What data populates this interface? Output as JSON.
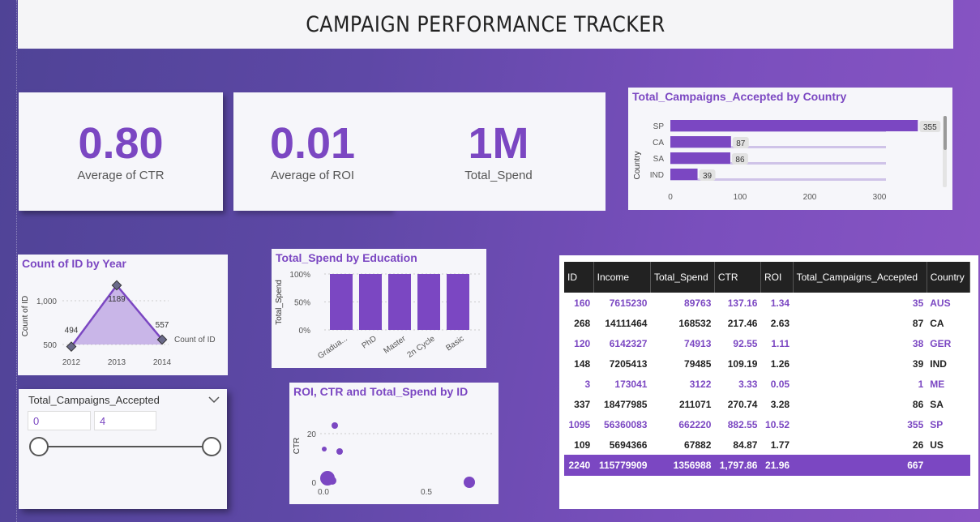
{
  "title": "CAMPAIGN PERFORMANCE TRACKER",
  "kpis": [
    {
      "value": "0.80",
      "label": "Average of CTR"
    },
    {
      "value": "0.01",
      "label": "Average of ROI"
    },
    {
      "value": "1M",
      "label": "Total_Spend"
    }
  ],
  "country_chart": {
    "title": "Total_Campaigns_Accepted by Country",
    "ylabel": "Country",
    "categories": [
      "SP",
      "CA",
      "SA",
      "IND"
    ],
    "values": [
      355,
      87,
      86,
      39
    ],
    "ticks": [
      "0",
      "100",
      "200",
      "300"
    ]
  },
  "year_chart": {
    "title": "Count of ID by Year",
    "ylabel": "Count of ID",
    "legend": "Count of ID",
    "years": [
      "2012",
      "2013",
      "2014"
    ],
    "values": [
      494,
      1189,
      557
    ],
    "labels": [
      "494",
      "1189",
      "557"
    ],
    "yticks": [
      "500",
      "1,000"
    ]
  },
  "education_chart": {
    "title": "Total_Spend by Education",
    "ylabel": "Total_Spend",
    "categories": [
      "Gradua...",
      "PhD",
      "Master",
      "2n Cycle",
      "Basic"
    ],
    "values": [
      100,
      100,
      100,
      100,
      100
    ],
    "yticks": [
      "0%",
      "50%",
      "100%"
    ]
  },
  "scatter_chart": {
    "title": "ROI, CTR and Total_Spend by ID",
    "ylabel": "CTR",
    "yticks": [
      "0",
      "20"
    ],
    "xticks": [
      "0.0",
      "0.5"
    ]
  },
  "slicer": {
    "title": "Total_Campaigns_Accepted",
    "min": "0",
    "max": "4"
  },
  "table": {
    "headers": [
      "ID",
      "Income",
      "Total_Spend",
      "CTR",
      "ROI",
      "Total_Campaigns_Accepted",
      "Country"
    ],
    "rows": [
      [
        "160",
        "7615230",
        "89763",
        "137.16",
        "1.34",
        "35",
        "AUS"
      ],
      [
        "268",
        "14111464",
        "168532",
        "217.46",
        "2.63",
        "87",
        "CA"
      ],
      [
        "120",
        "6142327",
        "74913",
        "92.55",
        "1.11",
        "38",
        "GER"
      ],
      [
        "148",
        "7205413",
        "79485",
        "109.19",
        "1.26",
        "39",
        "IND"
      ],
      [
        "3",
        "173041",
        "3122",
        "3.33",
        "0.05",
        "1",
        "ME"
      ],
      [
        "337",
        "18477985",
        "211071",
        "270.74",
        "3.28",
        "86",
        "SA"
      ],
      [
        "1095",
        "56360083",
        "662220",
        "882.55",
        "10.52",
        "355",
        "SP"
      ],
      [
        "109",
        "5694366",
        "67882",
        "84.87",
        "1.77",
        "26",
        "US"
      ]
    ],
    "total": [
      "2240",
      "115779909",
      "1356988",
      "1,797.86",
      "21.96",
      "667",
      ""
    ]
  },
  "colors": {
    "accent": "#7b47c2",
    "header": "#222222"
  }
}
